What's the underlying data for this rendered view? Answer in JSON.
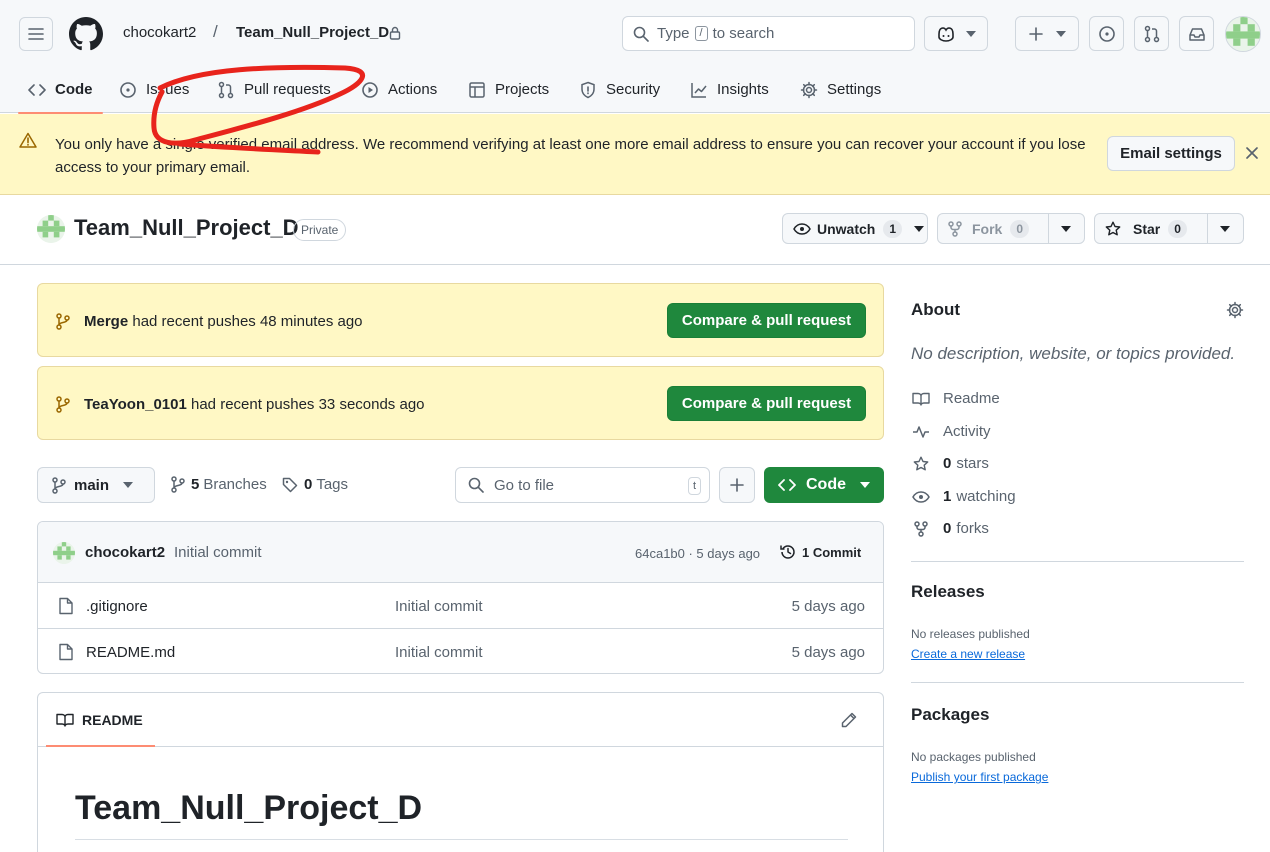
{
  "header": {
    "owner": "chocokart2",
    "separator": "/",
    "repo": "Team_Null_Project_D",
    "search_prefix": "Type",
    "search_key": "/",
    "search_suffix": "to search"
  },
  "tabs": [
    {
      "label": "Code",
      "icon": "code-icon"
    },
    {
      "label": "Issues",
      "icon": "issue-icon"
    },
    {
      "label": "Pull requests",
      "icon": "pull-request-icon"
    },
    {
      "label": "Actions",
      "icon": "play-icon"
    },
    {
      "label": "Projects",
      "icon": "table-icon"
    },
    {
      "label": "Security",
      "icon": "shield-icon"
    },
    {
      "label": "Insights",
      "icon": "graph-icon"
    },
    {
      "label": "Settings",
      "icon": "gear-icon"
    }
  ],
  "banner": {
    "message": "You only have a single verified email address. We recommend verifying at least one more email address to ensure you can recover your account if you lose access to your primary email.",
    "button": "Email settings",
    "color": "#fff8c5"
  },
  "repo_header": {
    "name": "Team_Null_Project_D",
    "visibility": "Private",
    "unwatch_label": "Unwatch",
    "unwatch_count": "1",
    "fork_label": "Fork",
    "fork_count": "0",
    "star_label": "Star",
    "star_count": "0"
  },
  "pushes": [
    {
      "branch": "Merge",
      "text": "had recent pushes 48 minutes ago",
      "button": "Compare & pull request"
    },
    {
      "branch": "TeaYoon_0101",
      "text": "had recent pushes 33 seconds ago",
      "button": "Compare & pull request"
    }
  ],
  "file_nav": {
    "branch": "main",
    "branches_count": "5",
    "branches_label": "Branches",
    "tags_count": "0",
    "tags_label": "Tags",
    "go_to_file": "Go to file",
    "shortcut": "t",
    "code_button": "Code"
  },
  "latest_commit": {
    "author": "chocokart2",
    "message": "Initial commit",
    "hash_time": "64ca1b0 · 5 days ago",
    "count_label": "1 Commit"
  },
  "files": [
    {
      "name": ".gitignore",
      "message": "Initial commit",
      "date": "5 days ago"
    },
    {
      "name": "README.md",
      "message": "Initial commit",
      "date": "5 days ago"
    }
  ],
  "readme": {
    "tab_label": "README",
    "title": "Team_Null_Project_D"
  },
  "sidebar": {
    "about_title": "About",
    "description": "No description, website, or topics provided.",
    "items": [
      {
        "icon": "book-icon",
        "count": "",
        "label": "Readme"
      },
      {
        "icon": "pulse-icon",
        "count": "",
        "label": "Activity"
      },
      {
        "icon": "star-icon",
        "count": "0",
        "label": "stars"
      },
      {
        "icon": "eye-icon",
        "count": "1",
        "label": "watching"
      },
      {
        "icon": "fork-icon",
        "count": "0",
        "label": "forks"
      }
    ],
    "releases_title": "Releases",
    "releases_note": "No releases published",
    "releases_link": "Create a new release",
    "packages_title": "Packages",
    "packages_note": "No packages published",
    "packages_link": "Publish your first package"
  },
  "colors": {
    "accent_green": "#1f883d",
    "tab_underline": "#fd8c73",
    "link_blue": "#0969da",
    "annotation_red": "#e8241c"
  }
}
